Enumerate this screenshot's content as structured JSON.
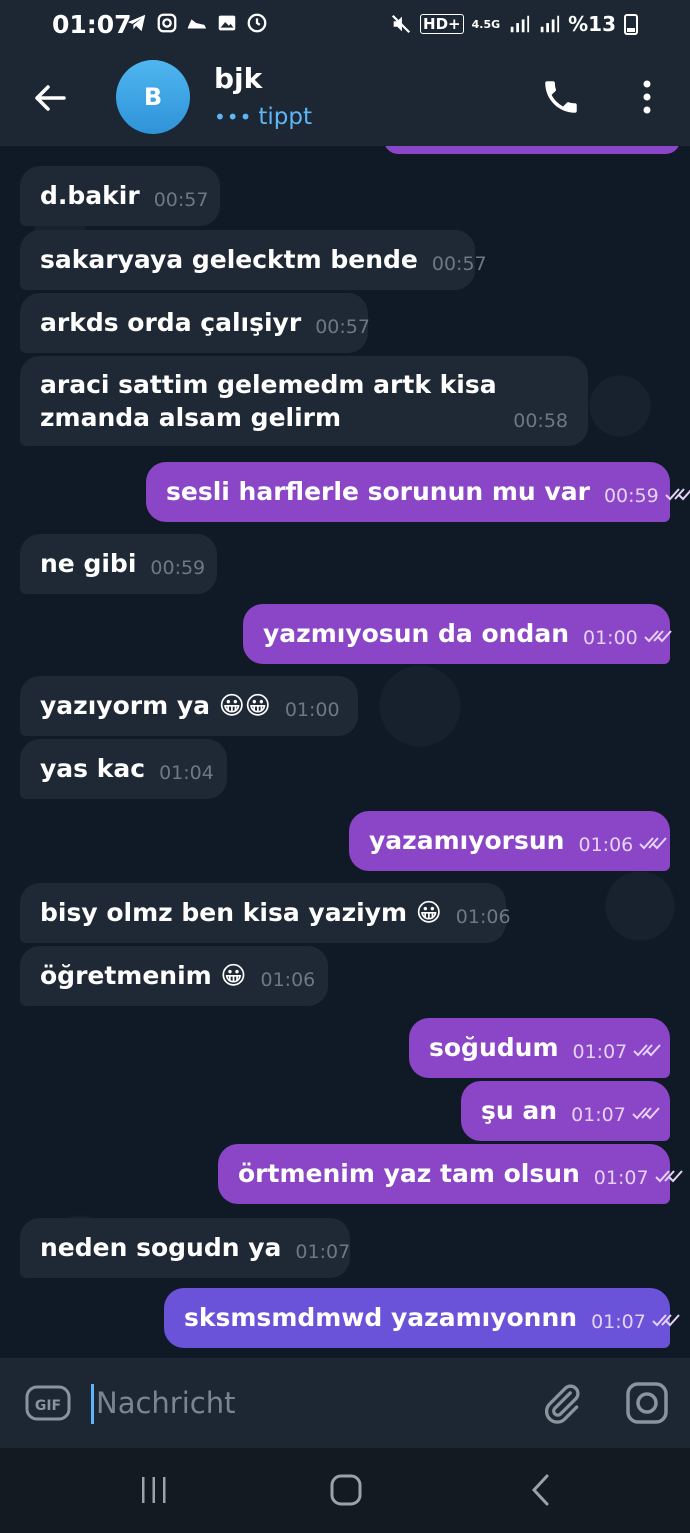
{
  "status_bar": {
    "time": "01:07",
    "battery": "%13",
    "network": "4.5G",
    "hd": "HD+"
  },
  "header": {
    "avatar_letter": "B",
    "contact_name": "bjk",
    "status": "tippt",
    "status_dots": "•••"
  },
  "messages": [
    {
      "dir": "in",
      "text": "d.bakir",
      "time": "00:57"
    },
    {
      "dir": "in",
      "text": "sakaryaya gelecktm bende",
      "time": "00:57"
    },
    {
      "dir": "in",
      "text": "arkds orda çalışiyr",
      "time": "00:57"
    },
    {
      "dir": "in",
      "text": "araci sattim gelemedm artk kisa zmanda alsam gelirm",
      "time": "00:58"
    },
    {
      "dir": "out",
      "text": "sesli harflerle sorunun mu var",
      "time": "00:59"
    },
    {
      "dir": "in",
      "text": "ne gibi",
      "time": "00:59"
    },
    {
      "dir": "out",
      "text": "yazmıyosun  da ondan",
      "time": "01:00"
    },
    {
      "dir": "in",
      "text": "yazıyorm ya 😀😀",
      "time": "01:00"
    },
    {
      "dir": "in",
      "text": "yas kac",
      "time": "01:04"
    },
    {
      "dir": "out",
      "text": "yazamıyorsun",
      "time": "01:06"
    },
    {
      "dir": "in",
      "text": "bisy olmz ben kisa yaziym 😀",
      "time": "01:06"
    },
    {
      "dir": "in",
      "text": "öğretmenim 😀",
      "time": "01:06"
    },
    {
      "dir": "out",
      "text": "soğudum",
      "time": "01:07"
    },
    {
      "dir": "out",
      "text": "şu an",
      "time": "01:07"
    },
    {
      "dir": "out",
      "text": "örtmenim yaz tam olsun",
      "time": "01:07"
    },
    {
      "dir": "in",
      "text": "neden sogudn ya",
      "time": "01:07"
    },
    {
      "dir": "out",
      "text": "sksmsmdmwd yazamıyonnn",
      "time": "01:07"
    }
  ],
  "composer": {
    "placeholder": "Nachricht",
    "gif_label": "GIF"
  },
  "colors": {
    "incoming_bubble": "#1f2936",
    "outgoing_bubble": "#8b46c8",
    "outgoing_bubble_alt": "#6a53d8",
    "accent": "#5eb5f7"
  }
}
